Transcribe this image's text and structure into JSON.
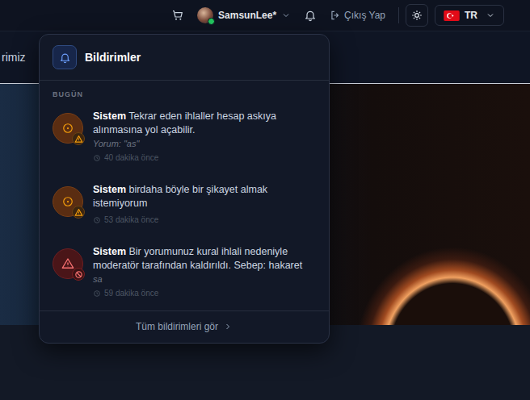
{
  "header": {
    "user": {
      "name": "SamsunLee*",
      "online": true
    },
    "logout": "Çıkış Yap",
    "language": "TR"
  },
  "nav": {
    "items": [
      "rimiz"
    ]
  },
  "notifications": {
    "title": "Bildirimler",
    "section": "BUGÜN",
    "items": [
      {
        "sender": "Sistem",
        "message": "Tekrar eden ihlaller hesap askıya alınmasına yol açabilir.",
        "comment": "Yorum: \"as\"",
        "time": "40 dakika önce",
        "kind": "warning"
      },
      {
        "sender": "Sistem",
        "message": "birdaha böyle bir şikayet almak istemiyorum",
        "time": "53 dakika önce",
        "kind": "warning"
      },
      {
        "sender": "Sistem",
        "message": "Bir yorumunuz kural ihlali nedeniyle moderatör tarafından kaldırıldı. Sebep: hakaret",
        "comment": "sa",
        "time": "59 dakika önce",
        "kind": "removal"
      }
    ],
    "footer": "Tüm bildirimleri gör"
  }
}
